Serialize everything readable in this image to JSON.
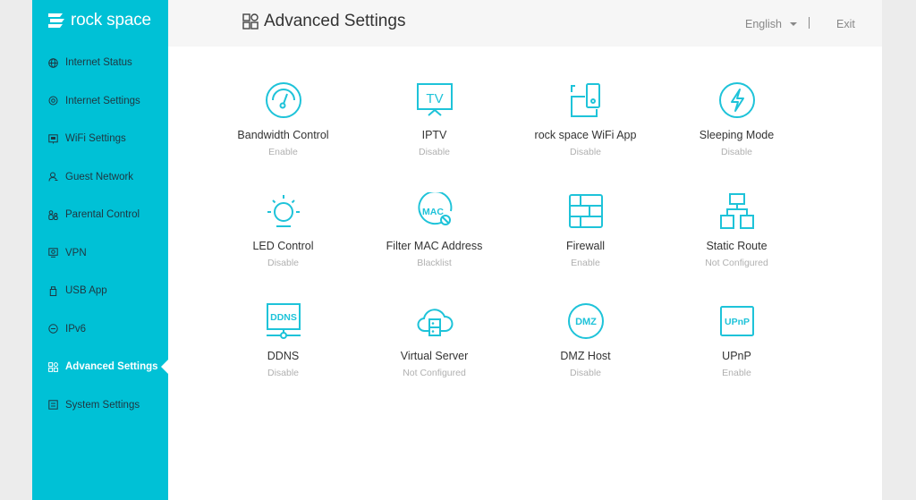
{
  "brand": {
    "name": "rock space",
    "color": "#00c1d6"
  },
  "sidebar": {
    "items": [
      {
        "label": "Internet Status",
        "icon": "globe-icon",
        "active": false
      },
      {
        "label": "Internet Settings",
        "icon": "internet-settings-icon",
        "active": false
      },
      {
        "label": "WiFi Settings",
        "icon": "wifi-settings-icon",
        "active": false
      },
      {
        "label": "Guest Network",
        "icon": "guest-user-icon",
        "active": false
      },
      {
        "label": "Parental Control",
        "icon": "parental-icon",
        "active": false
      },
      {
        "label": "VPN",
        "icon": "vpn-monitor-icon",
        "active": false
      },
      {
        "label": "USB App",
        "icon": "usb-icon",
        "active": false
      },
      {
        "label": "IPv6",
        "icon": "ipv6-icon",
        "active": false
      },
      {
        "label": "Advanced Settings",
        "icon": "grid-icon",
        "active": true
      },
      {
        "label": "System Settings",
        "icon": "system-settings-icon",
        "active": false
      }
    ]
  },
  "header": {
    "title": "Advanced Settings",
    "language": "English",
    "exit_label": "Exit"
  },
  "features": [
    {
      "name": "Bandwidth Control",
      "status": "Enable",
      "icon": "speedometer-icon"
    },
    {
      "name": "IPTV",
      "status": "Disable",
      "icon": "tv-icon",
      "icon_text": "TV"
    },
    {
      "name": "rock space WiFi App",
      "status": "Disable",
      "icon": "phone-app-icon"
    },
    {
      "name": "Sleeping Mode",
      "status": "Disable",
      "icon": "lightning-icon"
    },
    {
      "name": "LED Control",
      "status": "Disable",
      "icon": "bulb-icon"
    },
    {
      "name": "Filter MAC Address",
      "status": "Blacklist",
      "icon": "mac-filter-icon",
      "icon_text": "MAC"
    },
    {
      "name": "Firewall",
      "status": "Enable",
      "icon": "firewall-icon"
    },
    {
      "name": "Static Route",
      "status": "Not Configured",
      "icon": "route-tree-icon"
    },
    {
      "name": "DDNS",
      "status": "Disable",
      "icon": "ddns-icon",
      "icon_text": "DDNS"
    },
    {
      "name": "Virtual Server",
      "status": "Not Configured",
      "icon": "cloud-server-icon"
    },
    {
      "name": "DMZ Host",
      "status": "Disable",
      "icon": "dmz-icon",
      "icon_text": "DMZ"
    },
    {
      "name": "UPnP",
      "status": "Enable",
      "icon": "upnp-icon",
      "icon_text": "UPnP"
    }
  ]
}
